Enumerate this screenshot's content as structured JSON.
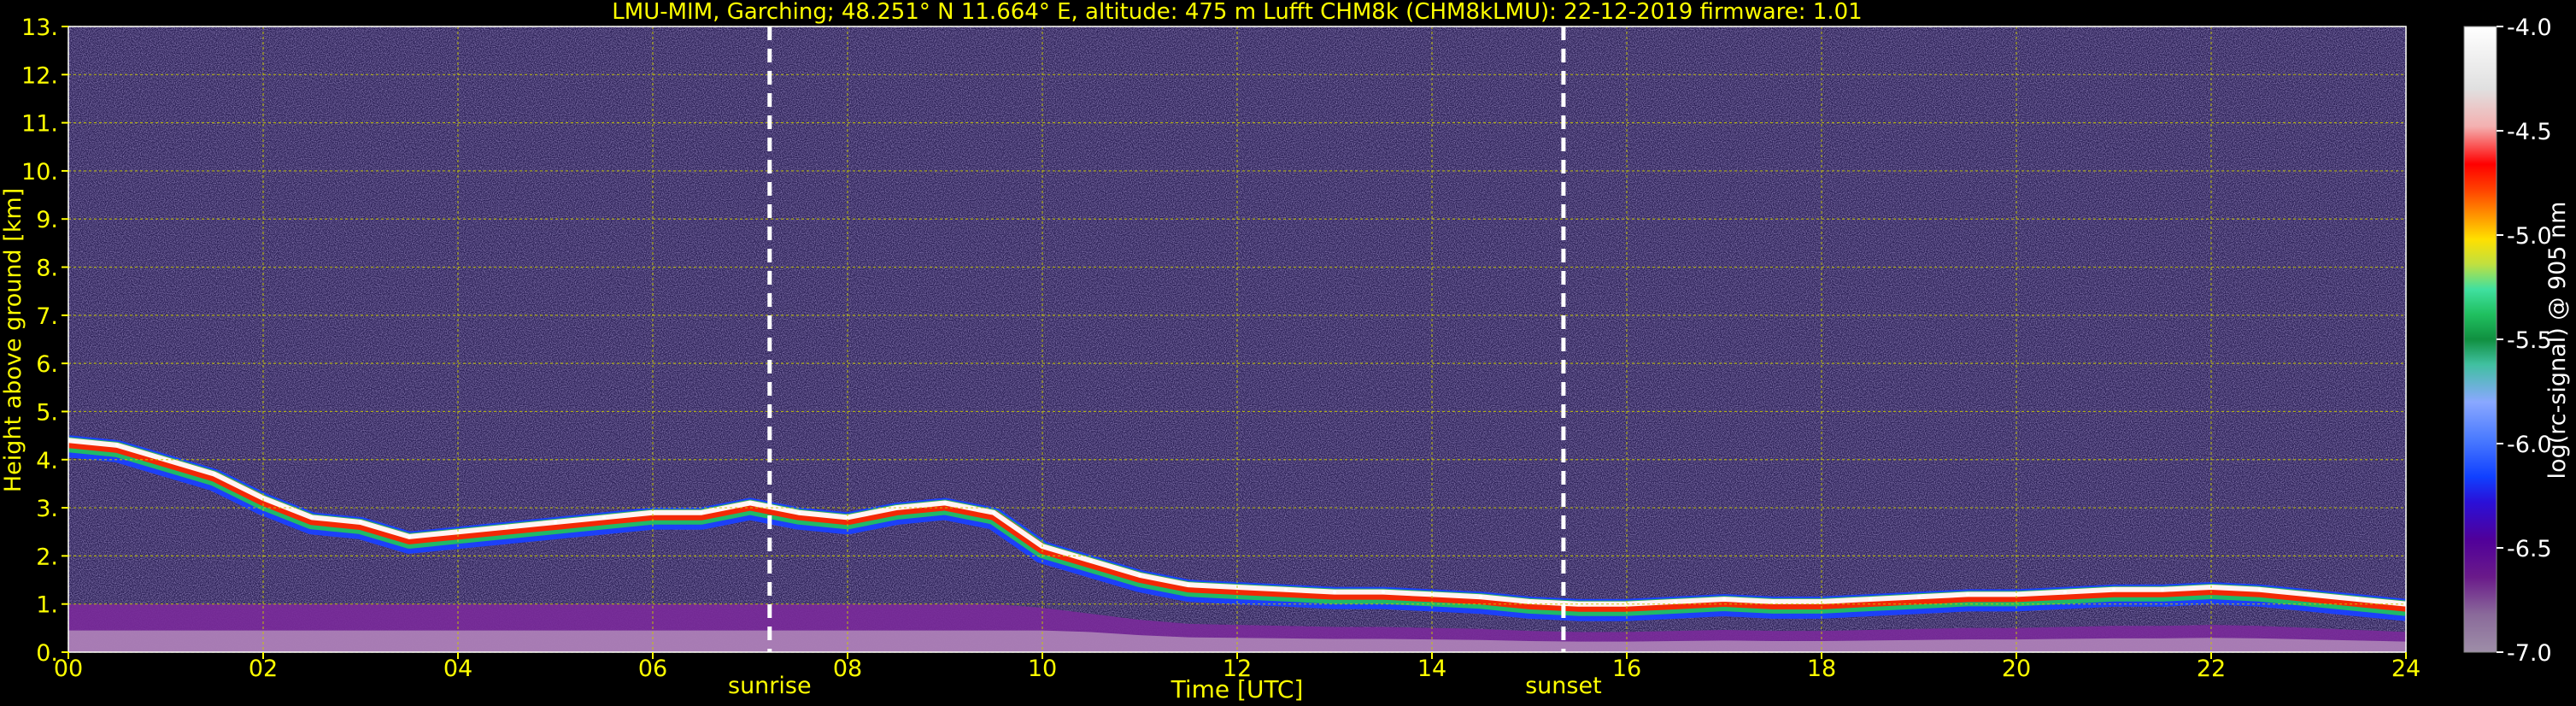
{
  "chart_data": {
    "type": "heatmap",
    "title": "LMU-MIM, Garching; 48.251° N 11.664° E, altitude: 475 m    Lufft CHM8k (CHM8kLMU): 22-12-2019    firmware: 1.01",
    "xlabel": "Time [UTC]",
    "ylabel": "Height above ground [km]",
    "colorbar_label": "log(rc-signal) @ 905 nm",
    "xlim": [
      0,
      24
    ],
    "ylim": [
      0,
      13
    ],
    "clim": [
      -7.0,
      -4.0
    ],
    "grid": true,
    "x_ticks": [
      "00",
      "02",
      "04",
      "06",
      "08",
      "10",
      "12",
      "14",
      "16",
      "18",
      "20",
      "22",
      "24"
    ],
    "y_ticks": [
      "0.",
      "1.",
      "2.",
      "3.",
      "4.",
      "5.",
      "6.",
      "7.",
      "8.",
      "9.",
      "10.",
      "11.",
      "12.",
      "13."
    ],
    "colorbar_ticks": [
      "-7.0",
      "-6.5",
      "-6.0",
      "-5.5",
      "-5.0",
      "-4.5",
      "-4.0"
    ],
    "markers": [
      {
        "label": "sunrise",
        "time": 7.2
      },
      {
        "label": "sunset",
        "time": 15.35
      }
    ],
    "cloud_base_height_km": {
      "time": [
        0,
        0.5,
        1.0,
        1.5,
        2.0,
        2.5,
        3.0,
        3.5,
        4.0,
        4.5,
        5.0,
        5.5,
        6.0,
        6.5,
        7.0,
        7.5,
        8.0,
        8.5,
        9.0,
        9.5,
        10.0,
        10.5,
        11.0,
        11.5,
        12.0,
        12.5,
        13.0,
        13.5,
        14.0,
        14.5,
        15.0,
        15.5,
        16.0,
        16.5,
        17.0,
        17.5,
        18.0,
        18.5,
        19.0,
        19.5,
        20.0,
        20.5,
        21.0,
        21.5,
        22.0,
        22.5,
        23.0,
        23.5,
        24.0
      ],
      "height": [
        4.4,
        4.3,
        4.0,
        3.7,
        3.2,
        2.8,
        2.7,
        2.4,
        2.5,
        2.6,
        2.7,
        2.8,
        2.9,
        2.9,
        3.1,
        2.9,
        2.8,
        3.0,
        3.1,
        2.9,
        2.2,
        1.9,
        1.6,
        1.4,
        1.35,
        1.3,
        1.25,
        1.25,
        1.2,
        1.15,
        1.05,
        1.0,
        1.0,
        1.05,
        1.1,
        1.05,
        1.05,
        1.1,
        1.15,
        1.2,
        1.2,
        1.25,
        1.3,
        1.3,
        1.35,
        1.3,
        1.2,
        1.1,
        1.0
      ]
    }
  }
}
